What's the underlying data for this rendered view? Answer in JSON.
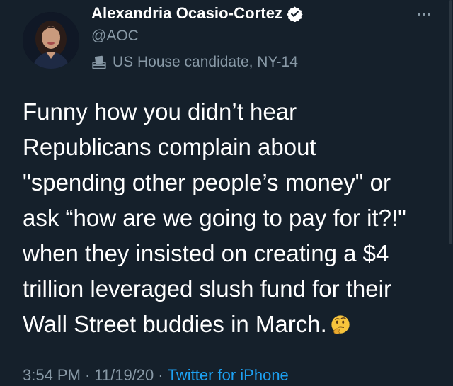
{
  "author": {
    "display_name": "Alexandria Ocasio-Cortez",
    "handle": "@AOC",
    "label": "US House candidate, NY-14",
    "verified": true,
    "avatar_icon": "profile-photo",
    "label_icon": "ballot-box-icon"
  },
  "tweet": {
    "lines": [
      "Funny how you didn’t hear",
      "Republicans complain about",
      "\"spending other people’s money\" or",
      "ask “how are we going to pay for it?!\"",
      "when they insisted on creating a $4",
      "trillion leveraged slush fund for their",
      "Wall Street buddies in March."
    ],
    "emoji": "thinking-face"
  },
  "meta": {
    "time": "3:54 PM",
    "date": "11/19/20",
    "separator": "·",
    "source": "Twitter for iPhone"
  },
  "colors": {
    "background": "#15202b",
    "text": "#ffffff",
    "secondary": "#8899a6",
    "accent": "#1da1f2"
  }
}
